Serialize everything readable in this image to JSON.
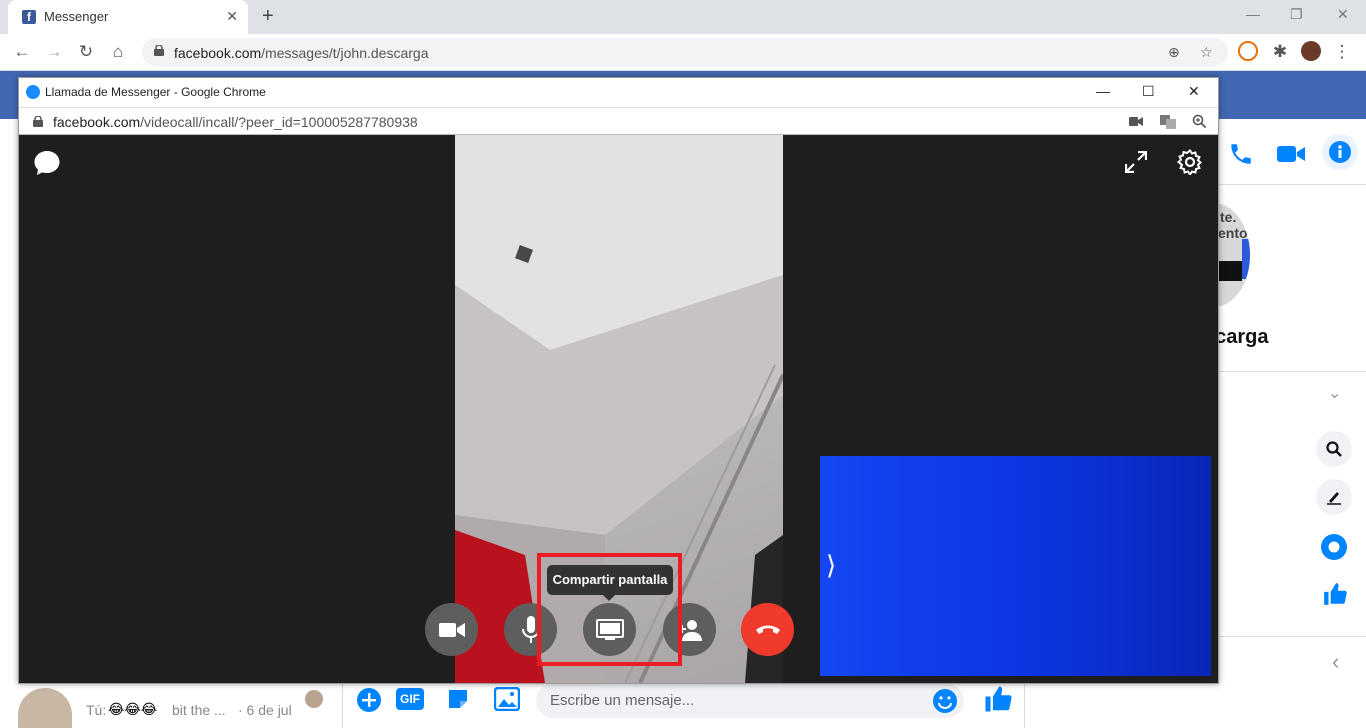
{
  "browser": {
    "tab_title": "Messenger",
    "url_domain": "facebook.com",
    "url_path": "/messages/t/john.descarga"
  },
  "popup": {
    "title": "Llamada de Messenger - Google Chrome",
    "url_domain": "facebook.com",
    "url_path": "/videocall/incall/?peer_id=100005287780938"
  },
  "call": {
    "tooltip": "Compartir pantalla",
    "controls": [
      "camera-toggle",
      "microphone-toggle",
      "share-screen",
      "add-person",
      "end-call"
    ]
  },
  "background_page": {
    "profile_name_fragment": "scarga",
    "profile_photo_text": [
      "te.",
      "ento"
    ],
    "conversation_preview": {
      "prefix": "Tú:",
      "emojis": "😂😂😂",
      "text": "bit the ...",
      "date": "· 6 de jul"
    },
    "composer_placeholder": "Escribe un mensaje..."
  },
  "colors": {
    "facebook_blue": "#4267b2",
    "messenger_accent": "#0084ff",
    "end_call_red": "#f03a2b",
    "highlight_red": "#ed1c24"
  }
}
